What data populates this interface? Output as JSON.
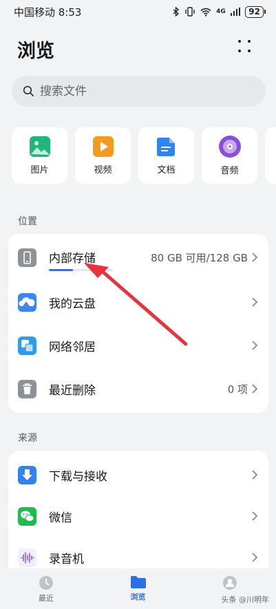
{
  "status_bar": {
    "carrier_time": "中国移动 8:53",
    "network": "4G",
    "battery": "92"
  },
  "header": {
    "title": "浏览"
  },
  "search": {
    "placeholder": "搜索文件"
  },
  "categories": [
    {
      "label": "图片",
      "icon": "image-icon",
      "color": "#1fb57c"
    },
    {
      "label": "视频",
      "icon": "video-icon",
      "color": "#f59a1c"
    },
    {
      "label": "文档",
      "icon": "document-icon",
      "color": "#2f84ee"
    },
    {
      "label": "音频",
      "icon": "audio-icon",
      "color": "#8a4fd8"
    }
  ],
  "locations": {
    "label": "位置",
    "items": [
      {
        "label": "内部存储",
        "value": "80 GB 可用/128 GB",
        "icon": "phone-icon",
        "used_fraction": 0.375
      },
      {
        "label": "我的云盘",
        "value": "",
        "icon": "cloud-drive-icon"
      },
      {
        "label": "网络邻居",
        "value": "",
        "icon": "network-icon"
      },
      {
        "label": "最近删除",
        "value": "0 项",
        "icon": "trash-icon"
      }
    ]
  },
  "sources": {
    "label": "来源",
    "items": [
      {
        "label": "下载与接收",
        "icon": "download-icon"
      },
      {
        "label": "微信",
        "icon": "wechat-icon"
      },
      {
        "label": "录音机",
        "icon": "recorder-icon"
      }
    ]
  },
  "bottom_nav": [
    {
      "label": "最近",
      "icon": "clock-icon"
    },
    {
      "label": "浏览",
      "icon": "folder-icon",
      "active": true
    },
    {
      "label": "",
      "icon": "user-icon"
    }
  ],
  "watermark": "头条 @川明年",
  "colors": {
    "accent": "#2f6fe4",
    "annotation": "#e8323c"
  }
}
